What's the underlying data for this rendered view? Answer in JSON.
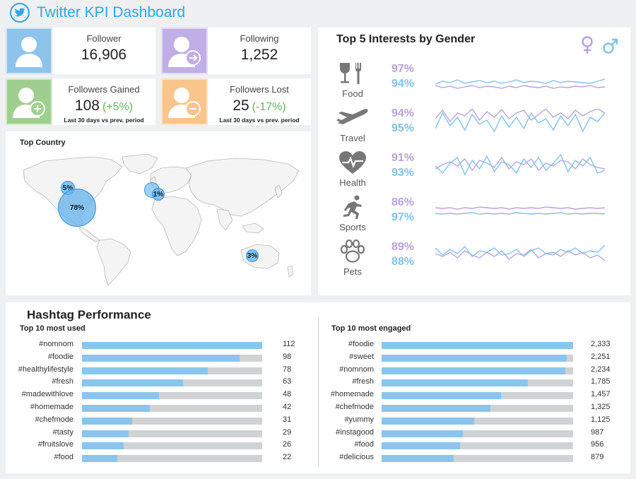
{
  "app": {
    "title": "Twitter KPI Dashboard"
  },
  "kpis": {
    "follower": {
      "label": "Follower",
      "value": "16,906"
    },
    "following": {
      "label": "Following",
      "value": "1,252"
    },
    "gained": {
      "label": "Followers Gained",
      "value": "108",
      "change": "(+5%)",
      "note": "Last 30 days vs prev. period"
    },
    "lost": {
      "label": "Followers Lost",
      "value": "25",
      "change": "(-17%)",
      "note": "Last 30 days vs prev. period"
    }
  },
  "colors": {
    "brand": "#2ea8e6",
    "female": "#b9a2de",
    "male": "#7fc3ea",
    "bar": "#8ac5ef",
    "track": "#d0d2d4",
    "positive": "#5fb35c"
  },
  "icons": {
    "header": "twitter-bird-icon",
    "follower": "user-icon",
    "following": "user-arrow-icon",
    "gained": "user-plus-icon",
    "lost": "user-minus-icon",
    "female": "female-symbol-icon",
    "male": "male-symbol-icon"
  },
  "map": {
    "title": "Top Country",
    "bubbles": [
      {
        "label": "5%"
      },
      {
        "label": "78%"
      },
      {
        "label": "1%"
      },
      {
        "label": "3%"
      }
    ]
  },
  "interests": {
    "title": "Top 5 Interests by Gender",
    "rows": [
      {
        "label": "Food",
        "icon": "fork-glass-icon",
        "female": "97%",
        "male": "94%"
      },
      {
        "label": "Travel",
        "icon": "airplane-icon",
        "female": "94%",
        "male": "95%"
      },
      {
        "label": "Health",
        "icon": "heart-pulse-icon",
        "female": "91%",
        "male": "93%"
      },
      {
        "label": "Sports",
        "icon": "runner-icon",
        "female": "86%",
        "male": "97%"
      },
      {
        "label": "Pets",
        "icon": "paw-icon",
        "female": "89%",
        "male": "88%"
      }
    ]
  },
  "hashtags": {
    "title": "Hashtag Performance",
    "used": {
      "title": "Top 10 most used",
      "max": 112,
      "items": [
        {
          "tag": "#nomnom",
          "value": 112,
          "display": "112"
        },
        {
          "tag": "#foodie",
          "value": 98,
          "display": "98"
        },
        {
          "tag": "#healthylifestyle",
          "value": 78,
          "display": "78"
        },
        {
          "tag": "#fresh",
          "value": 63,
          "display": "63"
        },
        {
          "tag": "#madewithlove",
          "value": 48,
          "display": "48"
        },
        {
          "tag": "#homemade",
          "value": 42,
          "display": "42"
        },
        {
          "tag": "#chefmode",
          "value": 31,
          "display": "31"
        },
        {
          "tag": "#tasty",
          "value": 29,
          "display": "29"
        },
        {
          "tag": "#fruitslove",
          "value": 26,
          "display": "26"
        },
        {
          "tag": "#food",
          "value": 22,
          "display": "22"
        }
      ]
    },
    "engaged": {
      "title": "Top 10 most engaged",
      "max": 2333,
      "items": [
        {
          "tag": "#foodie",
          "value": 2333,
          "display": "2,333"
        },
        {
          "tag": "#sweet",
          "value": 2251,
          "display": "2,251"
        },
        {
          "tag": "#nomnom",
          "value": 2234,
          "display": "2,234"
        },
        {
          "tag": "#fresh",
          "value": 1785,
          "display": "1,785"
        },
        {
          "tag": "#homemade",
          "value": 1457,
          "display": "1,457"
        },
        {
          "tag": "#chefmode",
          "value": 1325,
          "display": "1,325"
        },
        {
          "tag": "#yummy",
          "value": 1125,
          "display": "1,125"
        },
        {
          "tag": "#instagood",
          "value": 987,
          "display": "987"
        },
        {
          "tag": "#food",
          "value": 956,
          "display": "956"
        },
        {
          "tag": "#delicious",
          "value": 879,
          "display": "879"
        }
      ]
    }
  }
}
